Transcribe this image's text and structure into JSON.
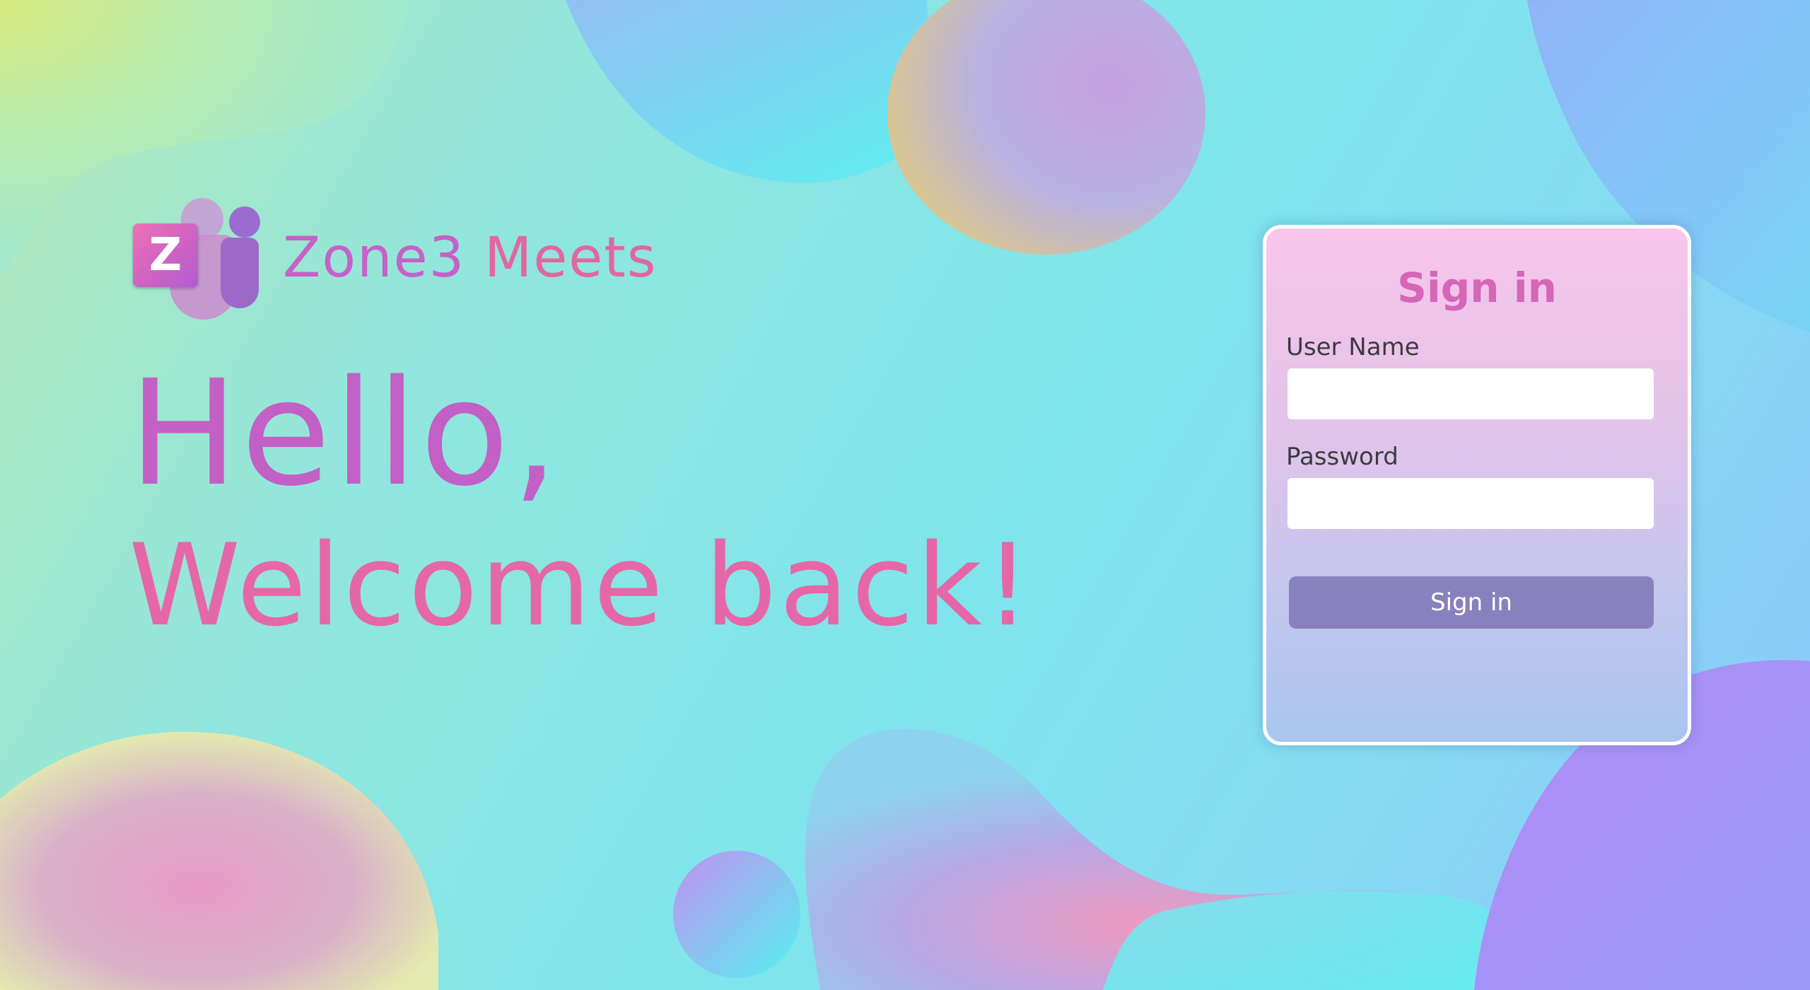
{
  "brand": {
    "logo_letter": "Z",
    "name_part1": "Zone3",
    "name_part2": "Meets"
  },
  "hero": {
    "line1": "Hello,",
    "line2": "Welcome back!"
  },
  "signin": {
    "title": "Sign in",
    "username_label": "User Name",
    "username_value": "",
    "password_label": "Password",
    "password_value": "",
    "submit_label": "Sign in"
  },
  "colors": {
    "accent_purple": "#c260c6",
    "accent_pink": "#e567a8",
    "button": "#8881bd"
  }
}
